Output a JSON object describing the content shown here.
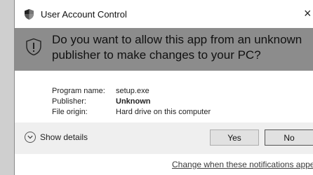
{
  "window": {
    "title": "User Account Control",
    "close_glyph": "×"
  },
  "prompt": {
    "question": "Do you want to allow this app from an unknown publisher to make changes to your PC?"
  },
  "details": {
    "rows": [
      {
        "label": "Program name:",
        "value": "setup.exe"
      },
      {
        "label": "Publisher:",
        "value": "Unknown"
      },
      {
        "label": "File origin:",
        "value": "Hard drive on this computer"
      }
    ]
  },
  "footer": {
    "show_details_label": "Show details",
    "yes_label": "Yes",
    "no_label": "No"
  },
  "link": {
    "text": "Change when these notifications appea"
  },
  "colors": {
    "header_bg": "#8c8c8c",
    "footer_bg": "#efefef"
  }
}
